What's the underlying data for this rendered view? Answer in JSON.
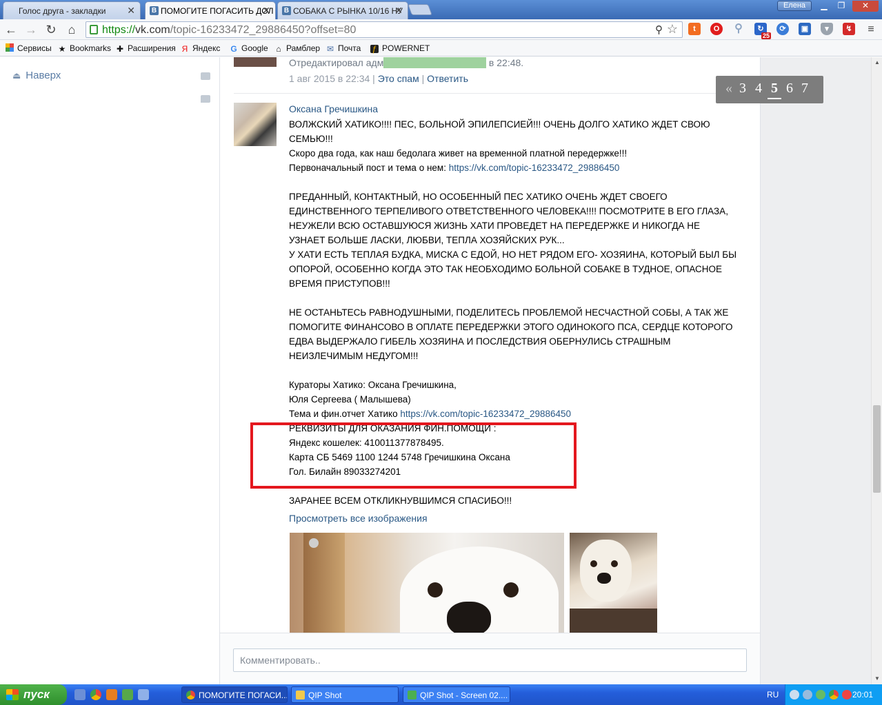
{
  "browser": {
    "tabs": [
      {
        "title": "Голос друга - закладки",
        "active": false
      },
      {
        "title": "ПОМОГИТЕ ПОГАСИТЬ ДОЛ",
        "active": true
      },
      {
        "title": "СОБАКА С РЫНКА 10/16 НУ",
        "active": false
      }
    ],
    "user": "Елена",
    "url_scheme": "https://",
    "url_host": "vk.com",
    "url_path": "/topic-16233472_29886450?offset=80",
    "bookmarks": [
      "Сервисы",
      "Bookmarks",
      "Расширения",
      "Яндекс",
      "Google",
      "Рамблер",
      "Почта",
      "POWERNET"
    ],
    "ext_badge": "25"
  },
  "sidebar": {
    "up_label": "Наверх"
  },
  "prev_post": {
    "edited": "Отредактировал администратор, 3 авг 2015 в 22:48.",
    "edited_prefix": "Отредактировал адм",
    "edited_hidden": "инистратор, 3 авг 2015",
    "edited_suffix": " в 22:48.",
    "date": "1 авг 2015 в 22:34",
    "spam": "Это спам",
    "reply": "Ответить"
  },
  "post": {
    "author": "Оксана Гречишкина",
    "lines": [
      "ВОЛЖСКИЙ ХАТИКО!!!! ПЕС, БОЛЬНОЙ ЭПИЛЕПСИЕЙ!!! ОЧЕНЬ ДОЛГО ХАТИКО ЖДЕТ СВОЮ СЕМЬЮ!!!",
      "Скоро два года, как наш бедолага живет на временной платной передержке!!!"
    ],
    "first_post_label": "Первоначальный пост и тема о нем: ",
    "link": "https://vk.com/topic-16233472_29886450",
    "para2": "ПРЕДАННЫЙ, КОНТАКТНЫЙ, НО ОСОБЕННЫЙ ПЕС ХАТИКО ОЧЕНЬ ЖДЕТ СВОЕГО ЕДИНСТВЕННОГО ТЕРПЕЛИВОГО ОТВЕТСТВЕННОГО ЧЕЛОВЕКА!!!! ПОСМОТРИТЕ В ЕГО ГЛАЗА, НЕУЖЕЛИ ВСЮ ОСТАВШУЮСЯ ЖИЗНЬ ХАТИ ПРОВЕДЕТ НА ПЕРЕДЕРЖКЕ И НИКОГДА НЕ УЗНАЕТ БОЛЬШЕ ЛАСКИ, ЛЮБВИ, ТЕПЛА ХОЗЯЙСКИХ РУК...",
    "para3": "У ХАТИ ЕСТЬ ТЕПЛАЯ БУДКА, МИСКА С ЕДОЙ, НО НЕТ РЯДОМ ЕГО- ХОЗЯИНА, КОТОРЫЙ БЫЛ БЫ ОПОРОЙ, ОСОБЕННО КОГДА ЭТО ТАК НЕОБХОДИМО БОЛЬНОЙ СОБАКЕ В ТУДНОЕ, ОПАСНОЕ ВРЕМЯ ПРИСТУПОВ!!!",
    "para4": "НЕ ОСТАНЬТЕСЬ РАВНОДУШНЫМИ, ПОДЕЛИТЕСЬ ПРОБЛЕМОЙ НЕСЧАСТНОЙ СОБЫ, А ТАК ЖЕ ПОМОГИТЕ ФИНАНСОВО В ОПЛАТЕ ПЕРЕДЕРЖКИ ЭТОГО ОДИНОКОГО ПСА, СЕРДЦЕ КОТОРОГО ЕДВА ВЫДЕРЖАЛО ГИБЕЛЬ ХОЗЯИНА И ПОСЛЕДСТВИЯ ОБЕРНУЛИСЬ СТРАШНЫМ НЕИЗЛЕЧИМЫМ НЕДУГОМ!!!",
    "curators1": "Кураторы Хатико: Оксана Гречишкина,",
    "curators2": "Юля Сергеева ( Малышева)",
    "report_label": "Тема и фин.отчет Хатико ",
    "req_title": "РЕКВИЗИТЫ ДЛЯ ОКАЗАНИЯ ФИН.ПОМОЩИ :",
    "req_yandex": "Яндекс кошелек: 410011377878495.",
    "req_card": "Карта СБ 5469 1100 1244 5748 Гречишкина Оксана",
    "req_phone": "Гол. Билайн 89033274201",
    "thanks": "ЗАРАНЕЕ ВСЕМ ОТКЛИКНУВШИМСЯ СПАСИБО!!!",
    "view_all": "Просмотреть все изображения"
  },
  "comment": {
    "placeholder": "Комментировать.."
  },
  "pagination": {
    "prev": "«",
    "pages": [
      "3",
      "4",
      "5",
      "6",
      "7"
    ],
    "current": "5"
  },
  "taskbar": {
    "start": "пуск",
    "tasks": [
      "ПОМОГИТЕ ПОГАСИ...",
      "QIP Shot",
      "QIP Shot - Screen 02...."
    ],
    "lang": "RU",
    "time": "20:01"
  },
  "colors": {
    "link": "#2a5885",
    "highlight_box": "#e4171e",
    "pagination_bg": "#7d7d7d"
  }
}
